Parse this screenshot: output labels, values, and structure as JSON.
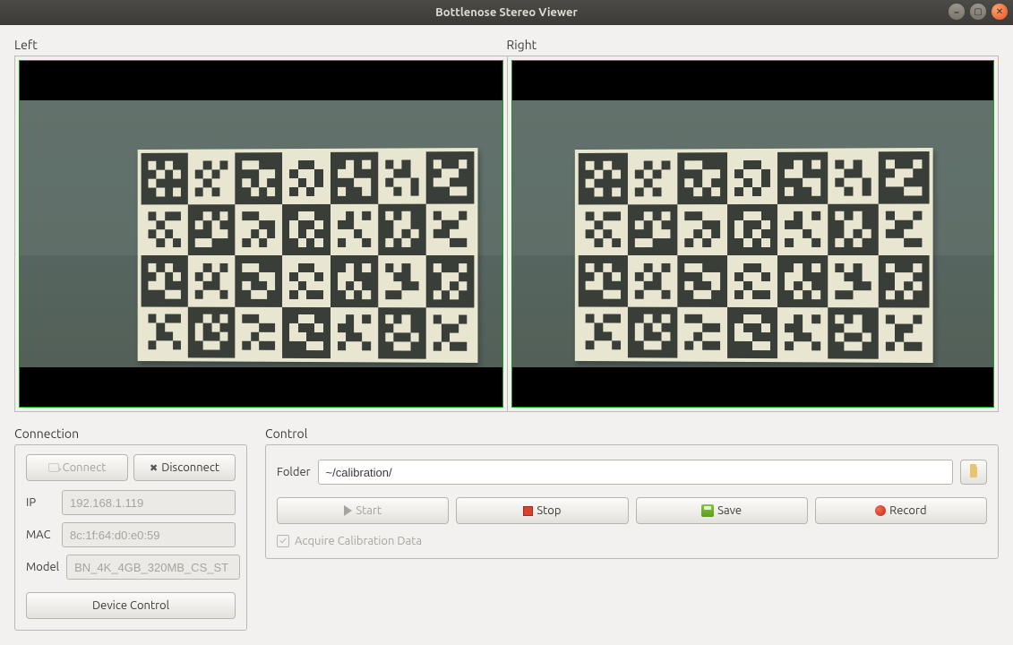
{
  "window": {
    "title": "Bottlenose Stereo Viewer"
  },
  "views": {
    "left_label": "Left",
    "right_label": "Right"
  },
  "connection": {
    "label": "Connection",
    "connect": "Connect",
    "disconnect": "Disconnect",
    "ip_label": "IP",
    "ip_value": "192.168.1.119",
    "mac_label": "MAC",
    "mac_value": "8c:1f:64:d0:e0:59",
    "model_label": "Model",
    "model_value": "BN_4K_4GB_320MB_CS_ST",
    "device_control": "Device Control"
  },
  "control": {
    "label": "Control",
    "folder_label": "Folder",
    "folder_value": "~/calibration/",
    "start": "Start",
    "stop": "Stop",
    "save": "Save",
    "record": "Record",
    "acquire": "Acquire Calibration Data",
    "acquire_checked": true
  }
}
